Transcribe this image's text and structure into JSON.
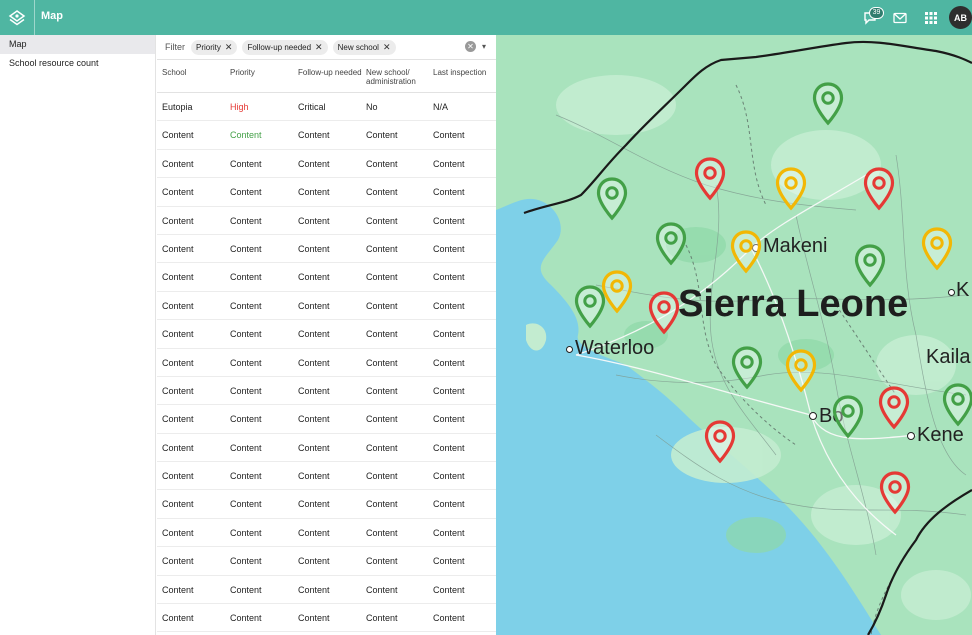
{
  "app": {
    "title": "Map",
    "notification_count": "39",
    "avatar_initials": "AB"
  },
  "colors": {
    "accent": "#4fb6a2",
    "high": "#e53935",
    "ok": "#43a047",
    "pin_red": "#e53935",
    "pin_green": "#43a047",
    "pin_yellow": "#f2b705"
  },
  "sidebar": {
    "items": [
      {
        "label": "Map",
        "active": true
      },
      {
        "label": "School resource count",
        "active": false
      }
    ]
  },
  "filter": {
    "label": "Filter",
    "chips": [
      "Priority",
      "Follow-up needed",
      "New school"
    ]
  },
  "table": {
    "headers": [
      "School",
      "Priority",
      "Follow-up needed",
      "New school/\nadministration",
      "Last inspection"
    ],
    "rows": [
      [
        "Eutopia",
        "High",
        "Critical",
        "No",
        "N/A"
      ],
      [
        "Content",
        "Content",
        "Content",
        "Content",
        "Content"
      ],
      [
        "Content",
        "Content",
        "Content",
        "Content",
        "Content"
      ],
      [
        "Content",
        "Content",
        "Content",
        "Content",
        "Content"
      ],
      [
        "Content",
        "Content",
        "Content",
        "Content",
        "Content"
      ],
      [
        "Content",
        "Content",
        "Content",
        "Content",
        "Content"
      ],
      [
        "Content",
        "Content",
        "Content",
        "Content",
        "Content"
      ],
      [
        "Content",
        "Content",
        "Content",
        "Content",
        "Content"
      ],
      [
        "Content",
        "Content",
        "Content",
        "Content",
        "Content"
      ],
      [
        "Content",
        "Content",
        "Content",
        "Content",
        "Content"
      ],
      [
        "Content",
        "Content",
        "Content",
        "Content",
        "Content"
      ],
      [
        "Content",
        "Content",
        "Content",
        "Content",
        "Content"
      ],
      [
        "Content",
        "Content",
        "Content",
        "Content",
        "Content"
      ],
      [
        "Content",
        "Content",
        "Content",
        "Content",
        "Content"
      ],
      [
        "Content",
        "Content",
        "Content",
        "Content",
        "Content"
      ],
      [
        "Content",
        "Content",
        "Content",
        "Content",
        "Content"
      ],
      [
        "Content",
        "Content",
        "Content",
        "Content",
        "Content"
      ],
      [
        "Content",
        "Content",
        "Content",
        "Content",
        "Content"
      ],
      [
        "Content",
        "Content",
        "Content",
        "Content",
        "Content"
      ]
    ]
  },
  "map": {
    "labels": {
      "country": "Sierra Leone",
      "city_makeni": "Makeni",
      "city_waterloo": "Waterloo",
      "city_bo": "Bo",
      "city_kenema": "Kene",
      "city_kailahun": "Kaila",
      "city_k": "K"
    },
    "pins": [
      {
        "status": "green"
      },
      {
        "status": "red"
      },
      {
        "status": "yellow"
      },
      {
        "status": "red"
      },
      {
        "status": "green"
      },
      {
        "status": "green"
      },
      {
        "status": "yellow"
      },
      {
        "status": "green"
      },
      {
        "status": "yellow"
      },
      {
        "status": "yellow"
      },
      {
        "status": "green"
      },
      {
        "status": "red"
      },
      {
        "status": "green"
      },
      {
        "status": "yellow"
      },
      {
        "status": "green"
      },
      {
        "status": "red"
      },
      {
        "status": "green"
      },
      {
        "status": "red"
      },
      {
        "status": "red"
      }
    ]
  }
}
